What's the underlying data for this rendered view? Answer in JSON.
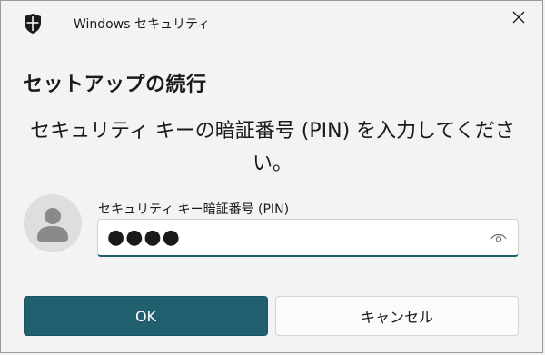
{
  "window": {
    "title": "Windows セキュリティ",
    "close_icon": "close-icon",
    "app_icon": "shield-icon"
  },
  "dialog": {
    "heading": "セットアップの続行",
    "instruction": "セキュリティ キーの暗証番号 (PIN) を入力してください。"
  },
  "pin_field": {
    "label": "セキュリティ キー暗証番号 (PIN)",
    "value": "●●●●",
    "reveal_icon": "eye-icon"
  },
  "buttons": {
    "ok": "OK",
    "cancel": "キャンセル"
  },
  "colors": {
    "accent": "#1f5f6e",
    "background": "#f3f3f3"
  }
}
